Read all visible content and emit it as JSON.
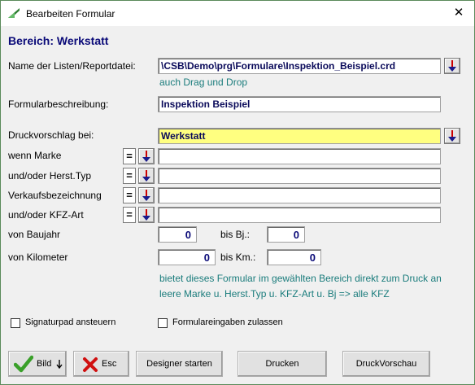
{
  "window": {
    "title": "Bearbeiten Formular",
    "close_glyph": "✕",
    "icon": "app-icon"
  },
  "section_title": "Bereich: Werkstatt",
  "form": {
    "file": {
      "label": "Name der Listen/Reportdatei:",
      "value": "\\CSB\\Demo\\prg\\Formulare\\Inspektion_Beispiel.crd",
      "hint": "auch Drag und Drop"
    },
    "description": {
      "label": "Formularbeschreibung:",
      "value": "Inspektion Beispiel"
    },
    "print_suggestion": {
      "label": "Druckvorschlag bei:",
      "value": "Werkstatt"
    },
    "marke": {
      "label": "wenn Marke",
      "operator": "=",
      "value": ""
    },
    "herst_typ": {
      "label": "und/oder Herst.Typ",
      "operator": "=",
      "value": ""
    },
    "verkaufsbez": {
      "label": "Verkaufsbezeichnung",
      "operator": "=",
      "value": ""
    },
    "kfz_art": {
      "label": "und/oder KFZ-Art",
      "operator": "=",
      "value": ""
    },
    "baujahr": {
      "label": "von Baujahr",
      "from": "0",
      "to_label": "bis Bj.:",
      "to": "0"
    },
    "kilometer": {
      "label": "von Kilometer",
      "from": "0",
      "to_label": "bis Km.:",
      "to": "0"
    },
    "info": {
      "line1": "bietet dieses Formular im gewählten Bereich direkt zum Druck an",
      "line2": "leere Marke u. Herst.Typ u. KFZ-Art u. Bj => alle KFZ"
    }
  },
  "checkboxes": {
    "signaturpad": {
      "label": "Signaturpad ansteuern",
      "checked": false
    },
    "formulareingaben": {
      "label": "Formulareingaben zulassen",
      "checked": false
    }
  },
  "buttons": {
    "bild": "Bild",
    "esc": "Esc",
    "designer": "Designer starten",
    "drucken": "Drucken",
    "vorschau": "DruckVorschau"
  },
  "colors": {
    "title_blue": "#0a0a78",
    "hint_teal": "#1a7c7c",
    "highlight_yellow": "#ffff80",
    "check_green": "#3aa02a",
    "esc_red": "#d01010"
  }
}
